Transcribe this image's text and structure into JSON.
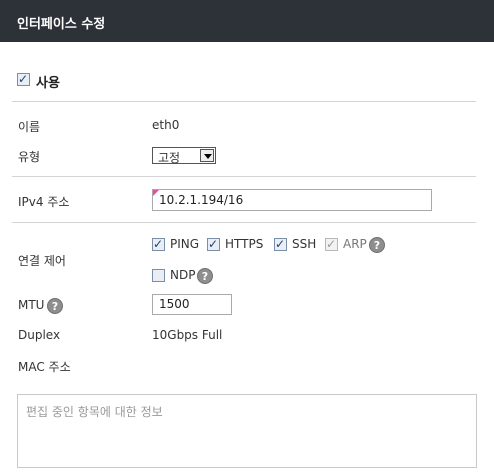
{
  "window": {
    "title": "인터페이스 수정"
  },
  "enable": {
    "label": "사용",
    "checked": true
  },
  "fields": {
    "name": {
      "label": "이름",
      "value": "eth0"
    },
    "type": {
      "label": "유형",
      "selected": "고정"
    },
    "ipv4": {
      "label": "IPv4 주소",
      "value": "10.2.1.194/16"
    },
    "connection_control": {
      "label": "연결 제어",
      "options": [
        {
          "label": "PING",
          "checked": true,
          "disabled": false
        },
        {
          "label": "HTTPS",
          "checked": true,
          "disabled": false
        },
        {
          "label": "SSH",
          "checked": true,
          "disabled": false
        },
        {
          "label": "ARP",
          "checked": true,
          "disabled": true
        },
        {
          "label": "NDP",
          "checked": false,
          "disabled": false
        }
      ]
    },
    "mtu": {
      "label": "MTU",
      "value": "1500"
    },
    "duplex": {
      "label": "Duplex",
      "value": "10Gbps Full"
    },
    "mac": {
      "label": "MAC 주소",
      "value": ""
    }
  },
  "help_icon": {
    "glyph": "?"
  },
  "info_box": {
    "placeholder": "편집 중인 항목에 대한 정보"
  },
  "colors": {
    "titlebar": "#2d3138",
    "separator": "#d4d4d4"
  }
}
